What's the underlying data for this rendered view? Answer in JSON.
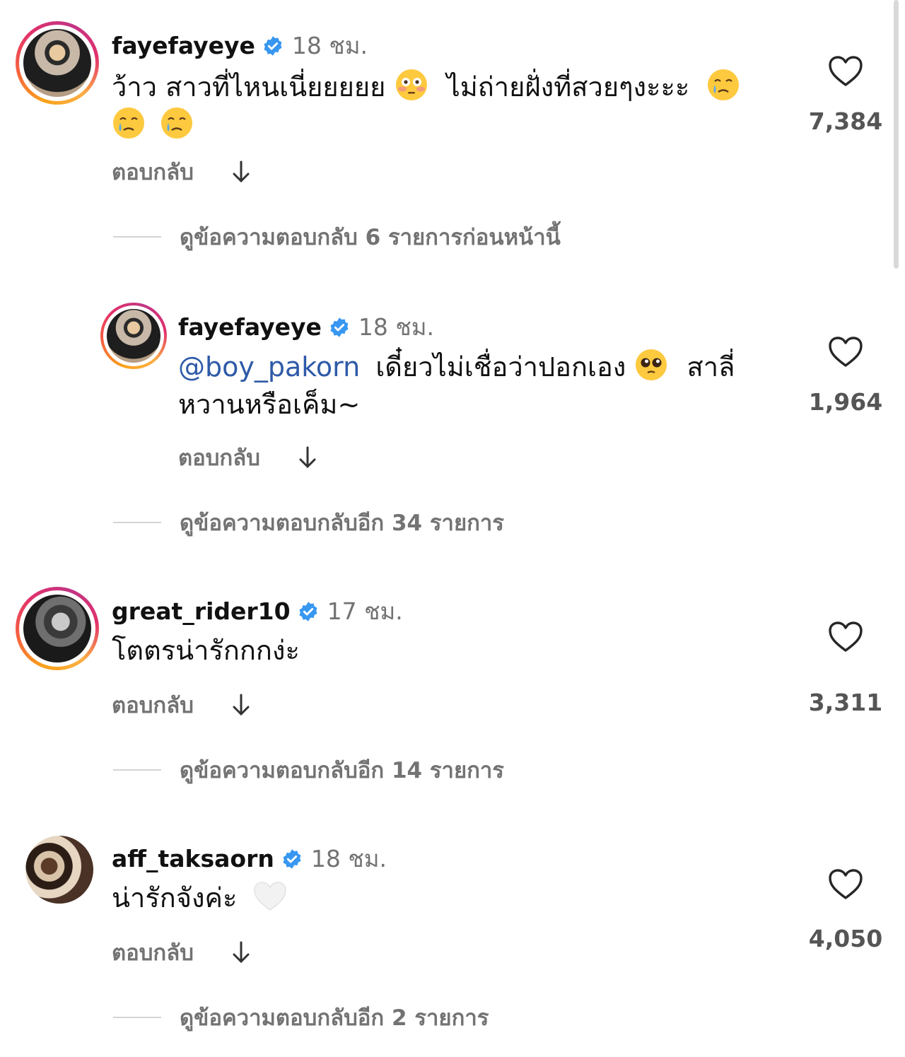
{
  "comments": [
    {
      "username": "fayefayeye",
      "time": "18 ชม.",
      "text": "ว้าว สาวที่ไหนเนี่ยยยยย",
      "text_mid": "ไม่ถ่ายฝั่งที่สวยๆงะะะ",
      "reply_label": "ตอบกลับ",
      "likes": "7,384",
      "view_replies": "ดูข้อความตอบกลับ 6 รายการก่อนหน้านี้"
    },
    {
      "username": "fayefayeye",
      "time": "18 ชม.",
      "mention": "@boy_pakorn",
      "text": "เดี๋ยวไม่เชื่อว่าปอกเอง",
      "text_tail": "สาลี่",
      "text_line2": "หวานหรือเค็ม~",
      "reply_label": "ตอบกลับ",
      "likes": "1,964",
      "view_replies": "ดูข้อความตอบกลับอีก 34 รายการ"
    },
    {
      "username": "great_rider10",
      "time": "17 ชม.",
      "text": "โตตรน่ารักกกง่ะ",
      "reply_label": "ตอบกลับ",
      "likes": "3,311",
      "view_replies": "ดูข้อความตอบกลับอีก 14 รายการ"
    },
    {
      "username": "aff_taksaorn",
      "time": "18 ชม.",
      "text": "น่ารักจังค่ะ",
      "reply_label": "ตอบกลับ",
      "likes": "4,050",
      "view_replies": "ดูข้อความตอบกลับอีก 2 รายการ"
    }
  ],
  "icons": {
    "verified": "verified-badge-icon",
    "heart": "heart-outline-icon",
    "reply_arrow": "arrow-down-icon"
  },
  "colors": {
    "verified_blue": "#3897f0",
    "mention_blue": "#2e5aa8",
    "muted_gray": "#737373"
  }
}
